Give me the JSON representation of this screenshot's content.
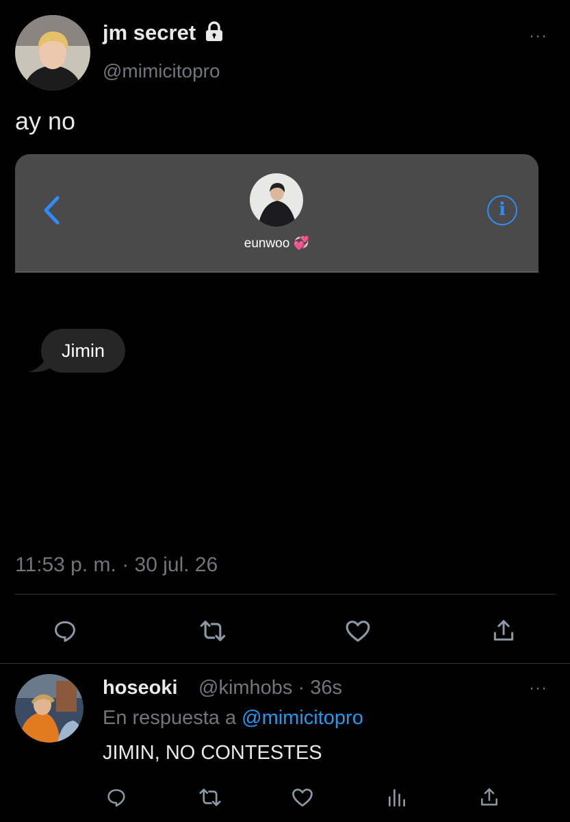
{
  "tweet": {
    "author_name": "jm secret",
    "author_handle": "@mimicitopro",
    "more_label": "···",
    "text": "ay no",
    "timestamp": "11:53 p. m. · 30 jul. 26"
  },
  "embedded_chat": {
    "contact_name": "eunwoo 💞",
    "message": "Jimin",
    "accent": "#2f8cff"
  },
  "actions": [
    "reply-icon",
    "retweet-icon",
    "like-icon",
    "share-icon"
  ],
  "reply": {
    "author_name": "hoseoki",
    "meta": "@kimhobs · 36s",
    "in_reply_prefix": "En respuesta a ",
    "in_reply_handle": "@mimicitopro",
    "text": "JIMIN, NO CONTESTES",
    "more_label": "···"
  },
  "colors": {
    "background": "#000000",
    "link": "#1d9bf0",
    "muted": "#71767b"
  }
}
